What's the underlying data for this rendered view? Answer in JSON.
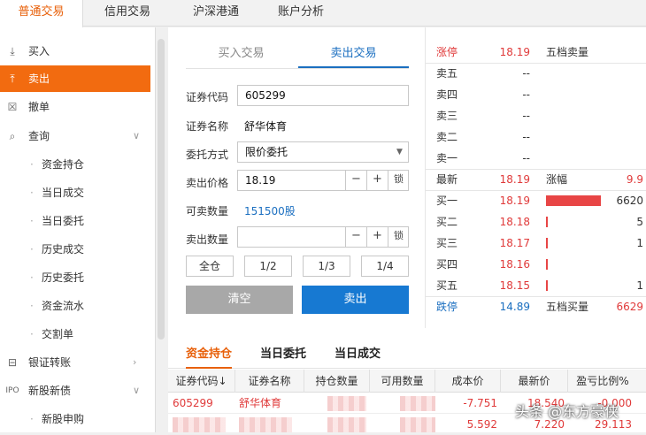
{
  "top_tabs": [
    "普通交易",
    "信用交易",
    "沪深港通",
    "账户分析"
  ],
  "sidebar": {
    "items": [
      {
        "icon": "download-icon",
        "glyph": "⤓",
        "label": "买入"
      },
      {
        "icon": "upload-icon",
        "glyph": "⤒",
        "label": "卖出"
      },
      {
        "icon": "cancel-box-icon",
        "glyph": "☒",
        "label": "撤单"
      },
      {
        "icon": "search-icon",
        "glyph": "⌕",
        "label": "查询"
      }
    ],
    "sub_items": [
      "资金持仓",
      "当日成交",
      "当日委托",
      "历史成交",
      "历史委托",
      "资金流水",
      "交割单"
    ],
    "bottom_items": [
      {
        "icon": "bank-transfer-icon",
        "glyph": "⊟",
        "label": "银证转账"
      },
      {
        "icon": "ipo-icon",
        "glyph": "IPO",
        "label": "新股新债"
      }
    ],
    "bottom_sub": [
      "新股申购"
    ]
  },
  "trade": {
    "tabs": [
      "买入交易",
      "卖出交易"
    ],
    "code_label": "证券代码",
    "code_value": "605299",
    "name_label": "证券名称",
    "name_value": "舒华体育",
    "method_label": "委托方式",
    "method_value": "限价委托",
    "price_label": "卖出价格",
    "price_value": "18.19",
    "sellable_label": "可卖数量",
    "sellable_value": "151500股",
    "qty_label": "卖出数量",
    "qty_value": "",
    "minus": "−",
    "plus": "+",
    "lock": "锁",
    "fractions": [
      "全仓",
      "1/2",
      "1/3",
      "1/4"
    ],
    "clear_label": "清空",
    "sell_label": "卖出"
  },
  "quote": {
    "limit_up": {
      "label": "涨停",
      "price": "18.19",
      "right_label": "五档卖量"
    },
    "sells": [
      {
        "label": "卖五",
        "price": "--"
      },
      {
        "label": "卖四",
        "price": "--"
      },
      {
        "label": "卖三",
        "price": "--"
      },
      {
        "label": "卖二",
        "price": "--"
      },
      {
        "label": "卖一",
        "price": "--"
      }
    ],
    "latest": {
      "label": "最新",
      "price": "18.19",
      "chg_label": "涨幅",
      "chg_value": "9.9"
    },
    "buys": [
      {
        "label": "买一",
        "price": "18.19",
        "vol": "6620",
        "bar": 1.0
      },
      {
        "label": "买二",
        "price": "18.18",
        "vol": "5",
        "bar": 0.03
      },
      {
        "label": "买三",
        "price": "18.17",
        "vol": "1",
        "bar": 0.03
      },
      {
        "label": "买四",
        "price": "18.16",
        "vol": "",
        "bar": 0.03
      },
      {
        "label": "买五",
        "price": "18.15",
        "vol": "1",
        "bar": 0.03
      }
    ],
    "limit_down": {
      "label": "跌停",
      "price": "14.89",
      "right_label": "五档买量",
      "right_value": "6629"
    }
  },
  "bottom_tabs": [
    "资金持仓",
    "当日委托",
    "当日成交"
  ],
  "table": {
    "headers": [
      "证券代码↓",
      "证券名称",
      "持仓数量",
      "可用数量",
      "成本价",
      "最新价",
      "盈亏比例%"
    ],
    "rows": [
      [
        "605299",
        "舒华体育",
        "",
        "",
        "-7.751",
        "18.540",
        "-0.000"
      ],
      [
        "",
        "",
        "",
        "",
        "5.592",
        "7.220",
        "29.113"
      ]
    ]
  },
  "colors": {
    "accent": "#f26b10",
    "blue": "#1779d2",
    "red": "#e03a3a"
  },
  "watermark": "头条 @东方豪侠"
}
